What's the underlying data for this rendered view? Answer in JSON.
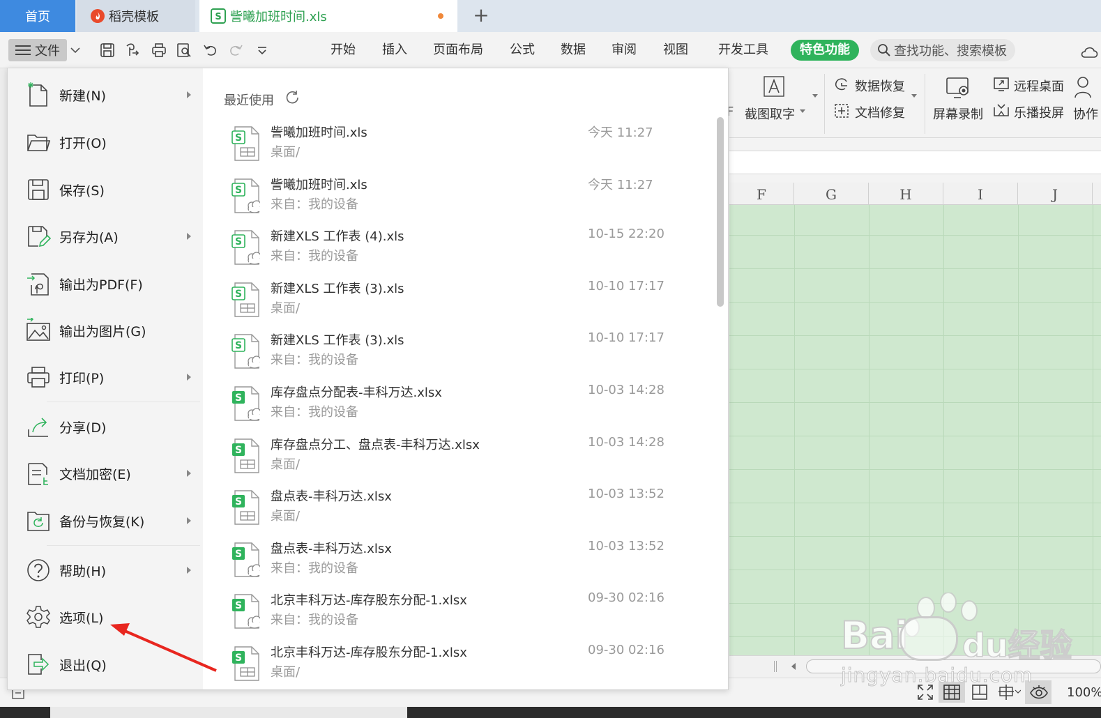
{
  "tabs": {
    "home": "首页",
    "template": "稻壳模板",
    "document": "訾曦加班时间.xls",
    "add": "+"
  },
  "toolbar": {
    "file_label": "文件",
    "menus": [
      "开始",
      "插入",
      "页面布局",
      "公式",
      "数据",
      "审阅",
      "视图",
      "开发工具"
    ],
    "special": "特色功能",
    "search_placeholder": "查找功能、搜索模板"
  },
  "ribbon": {
    "partial_char": "F",
    "screenshot_text": "截图取字",
    "data_recovery": "数据恢复",
    "doc_repair": "文档修复",
    "screen_record": "屏幕录制",
    "remote_desktop": "远程桌面",
    "cast_screen": "乐播投屏",
    "collab": "协作"
  },
  "sheet": {
    "columns": [
      "F",
      "G",
      "H",
      "I",
      "J"
    ],
    "zoom": "100%"
  },
  "file_menu": {
    "items": [
      {
        "label": "新建(N)",
        "arrow": true
      },
      {
        "label": "打开(O)",
        "arrow": false
      },
      {
        "label": "保存(S)",
        "arrow": false
      },
      {
        "label": "另存为(A)",
        "arrow": true
      },
      {
        "label": "输出为PDF(F)",
        "arrow": false
      },
      {
        "label": "输出为图片(G)",
        "arrow": false
      },
      {
        "label": "打印(P)",
        "arrow": true
      },
      {
        "label": "分享(D)",
        "arrow": false
      },
      {
        "label": "文档加密(E)",
        "arrow": true
      },
      {
        "label": "备份与恢复(K)",
        "arrow": true
      },
      {
        "label": "帮助(H)",
        "arrow": true
      },
      {
        "label": "选项(L)",
        "arrow": false
      },
      {
        "label": "退出(Q)",
        "arrow": false
      }
    ]
  },
  "recent": {
    "title": "最近使用",
    "files": [
      {
        "name": "訾曦加班时间.xls",
        "path": "桌面/",
        "time": "今天 11:27",
        "cloud": false,
        "ext": "xls"
      },
      {
        "name": "訾曦加班时间.xls",
        "path": "来自：我的设备",
        "time": "今天 11:27",
        "cloud": true,
        "ext": "xls"
      },
      {
        "name": "新建XLS 工作表 (4).xls",
        "path": "来自：我的设备",
        "time": "10-15 22:20",
        "cloud": true,
        "ext": "xls"
      },
      {
        "name": "新建XLS 工作表 (3).xls",
        "path": "桌面/",
        "time": "10-10 17:17",
        "cloud": false,
        "ext": "xls"
      },
      {
        "name": "新建XLS 工作表 (3).xls",
        "path": "来自：我的设备",
        "time": "10-10 17:17",
        "cloud": true,
        "ext": "xls"
      },
      {
        "name": "库存盘点分配表-丰科万达.xlsx",
        "path": "来自：我的设备",
        "time": "10-03 14:28",
        "cloud": true,
        "ext": "xlsx"
      },
      {
        "name": "库存盘点分工、盘点表-丰科万达.xlsx",
        "path": "桌面/",
        "time": "10-03 14:28",
        "cloud": false,
        "ext": "xlsx"
      },
      {
        "name": "盘点表-丰科万达.xlsx",
        "path": "桌面/",
        "time": "10-03 13:52",
        "cloud": false,
        "ext": "xlsx"
      },
      {
        "name": "盘点表-丰科万达.xlsx",
        "path": "来自：我的设备",
        "time": "10-03 13:52",
        "cloud": true,
        "ext": "xlsx"
      },
      {
        "name": "北京丰科万达-库存股东分配-1.xlsx",
        "path": "来自：我的设备",
        "time": "09-30 02:16",
        "cloud": true,
        "ext": "xlsx"
      },
      {
        "name": "北京丰科万达-库存股东分配-1.xlsx",
        "path": "桌面/",
        "time": "09-30 02:16",
        "cloud": false,
        "ext": "xlsx"
      }
    ]
  },
  "watermark": {
    "brand": "Baidu经验",
    "url": "jingyan.baidu.com"
  },
  "colors": {
    "tab_active_blue": "#3e8ae0",
    "brand_green": "#2fb35c",
    "sheet_bg": "#cfe8cf",
    "annotation_red": "#e8261f"
  }
}
